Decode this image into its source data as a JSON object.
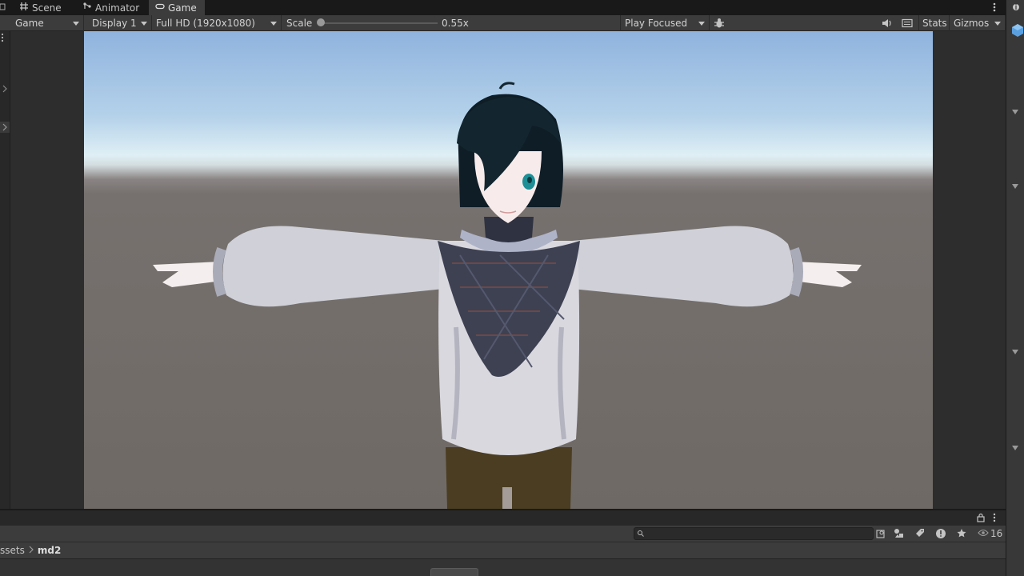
{
  "tabs": [
    {
      "label": "Scene",
      "icon": "grid-icon",
      "active": false
    },
    {
      "label": "Animator",
      "icon": "animator-icon",
      "active": false
    },
    {
      "label": "Game",
      "icon": "gamepad-icon",
      "active": true
    }
  ],
  "toolbar": {
    "display_mode": "Game",
    "display": "Display 1",
    "resolution": "Full HD (1920x1080)",
    "scale_label": "Scale",
    "scale_value": "0.55x",
    "scale_fraction": 0.0,
    "play_mode": "Play Focused",
    "stats_label": "Stats",
    "gizmos_label": "Gizmos"
  },
  "project": {
    "breadcrumb_root": "ssets",
    "breadcrumb_current": "md2",
    "hidden_count": "16"
  },
  "colors": {
    "panel": "#3c3c3c",
    "background": "#191919",
    "sky_top": "#8fb3de",
    "ground": "#6f6965"
  }
}
